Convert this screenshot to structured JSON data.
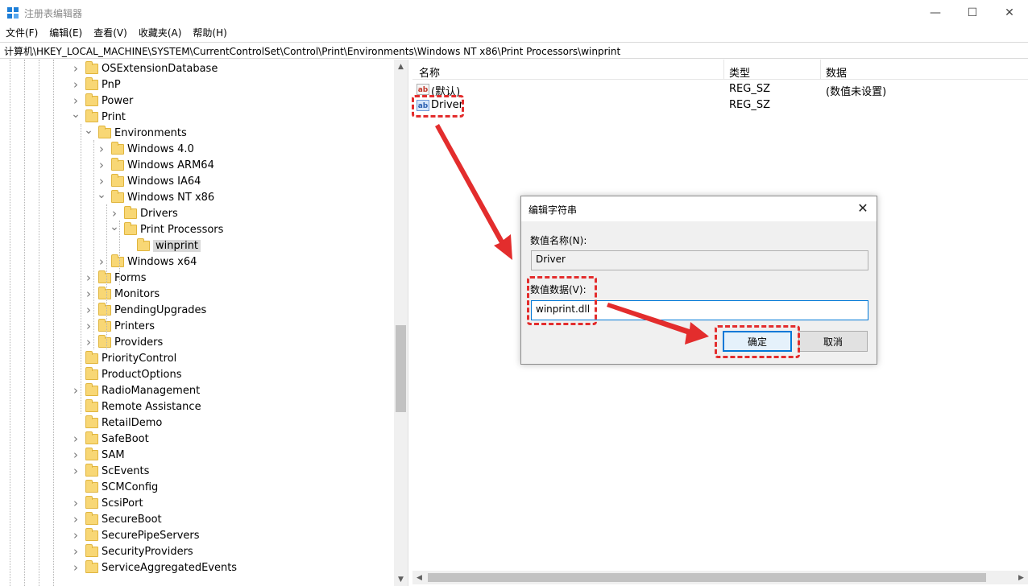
{
  "window": {
    "title": "注册表编辑器",
    "app_icon": "regedit-icon"
  },
  "menu": [
    "文件(F)",
    "编辑(E)",
    "查看(V)",
    "收藏夹(A)",
    "帮助(H)"
  ],
  "address": "计算机\\HKEY_LOCAL_MACHINE\\SYSTEM\\CurrentControlSet\\Control\\Print\\Environments\\Windows NT x86\\Print Processors\\winprint",
  "tree": [
    {
      "label": "OSExtensionDatabase",
      "depth": 0,
      "expander": "collapsed"
    },
    {
      "label": "PnP",
      "depth": 0,
      "expander": "collapsed"
    },
    {
      "label": "Power",
      "depth": 0,
      "expander": "collapsed"
    },
    {
      "label": "Print",
      "depth": 0,
      "expander": "expanded"
    },
    {
      "label": "Environments",
      "depth": 1,
      "expander": "expanded"
    },
    {
      "label": "Windows 4.0",
      "depth": 2,
      "expander": "collapsed"
    },
    {
      "label": "Windows ARM64",
      "depth": 2,
      "expander": "collapsed"
    },
    {
      "label": "Windows IA64",
      "depth": 2,
      "expander": "collapsed"
    },
    {
      "label": "Windows NT x86",
      "depth": 2,
      "expander": "expanded"
    },
    {
      "label": "Drivers",
      "depth": 3,
      "expander": "collapsed"
    },
    {
      "label": "Print Processors",
      "depth": 3,
      "expander": "expanded"
    },
    {
      "label": "winprint",
      "depth": 4,
      "expander": "none",
      "selected": true
    },
    {
      "label": "Windows x64",
      "depth": 2,
      "expander": "collapsed"
    },
    {
      "label": "Forms",
      "depth": 1,
      "expander": "collapsed"
    },
    {
      "label": "Monitors",
      "depth": 1,
      "expander": "collapsed"
    },
    {
      "label": "PendingUpgrades",
      "depth": 1,
      "expander": "collapsed"
    },
    {
      "label": "Printers",
      "depth": 1,
      "expander": "collapsed"
    },
    {
      "label": "Providers",
      "depth": 1,
      "expander": "collapsed"
    },
    {
      "label": "PriorityControl",
      "depth": 0,
      "expander": "none"
    },
    {
      "label": "ProductOptions",
      "depth": 0,
      "expander": "none"
    },
    {
      "label": "RadioManagement",
      "depth": 0,
      "expander": "collapsed"
    },
    {
      "label": "Remote Assistance",
      "depth": 0,
      "expander": "none"
    },
    {
      "label": "RetailDemo",
      "depth": 0,
      "expander": "none"
    },
    {
      "label": "SafeBoot",
      "depth": 0,
      "expander": "collapsed"
    },
    {
      "label": "SAM",
      "depth": 0,
      "expander": "collapsed"
    },
    {
      "label": "ScEvents",
      "depth": 0,
      "expander": "collapsed"
    },
    {
      "label": "SCMConfig",
      "depth": 0,
      "expander": "none"
    },
    {
      "label": "ScsiPort",
      "depth": 0,
      "expander": "collapsed"
    },
    {
      "label": "SecureBoot",
      "depth": 0,
      "expander": "collapsed"
    },
    {
      "label": "SecurePipeServers",
      "depth": 0,
      "expander": "collapsed"
    },
    {
      "label": "SecurityProviders",
      "depth": 0,
      "expander": "collapsed"
    },
    {
      "label": "ServiceAggregatedEvents",
      "depth": 0,
      "expander": "collapsed"
    }
  ],
  "list": {
    "columns": [
      "名称",
      "类型",
      "数据"
    ],
    "rows": [
      {
        "name": "(默认)",
        "type": "REG_SZ",
        "data": "(数值未设置)",
        "icon": "string-value-icon"
      },
      {
        "name": "Driver",
        "type": "REG_SZ",
        "data": "",
        "icon": "string-value-icon"
      }
    ]
  },
  "dialog": {
    "title": "编辑字符串",
    "name_label": "数值名称(N):",
    "name_value": "Driver",
    "data_label": "数值数据(V):",
    "data_value": "winprint.dll",
    "ok": "确定",
    "cancel": "取消"
  },
  "colors": {
    "annotation": "#e32d2d",
    "accent": "#0078d7"
  }
}
